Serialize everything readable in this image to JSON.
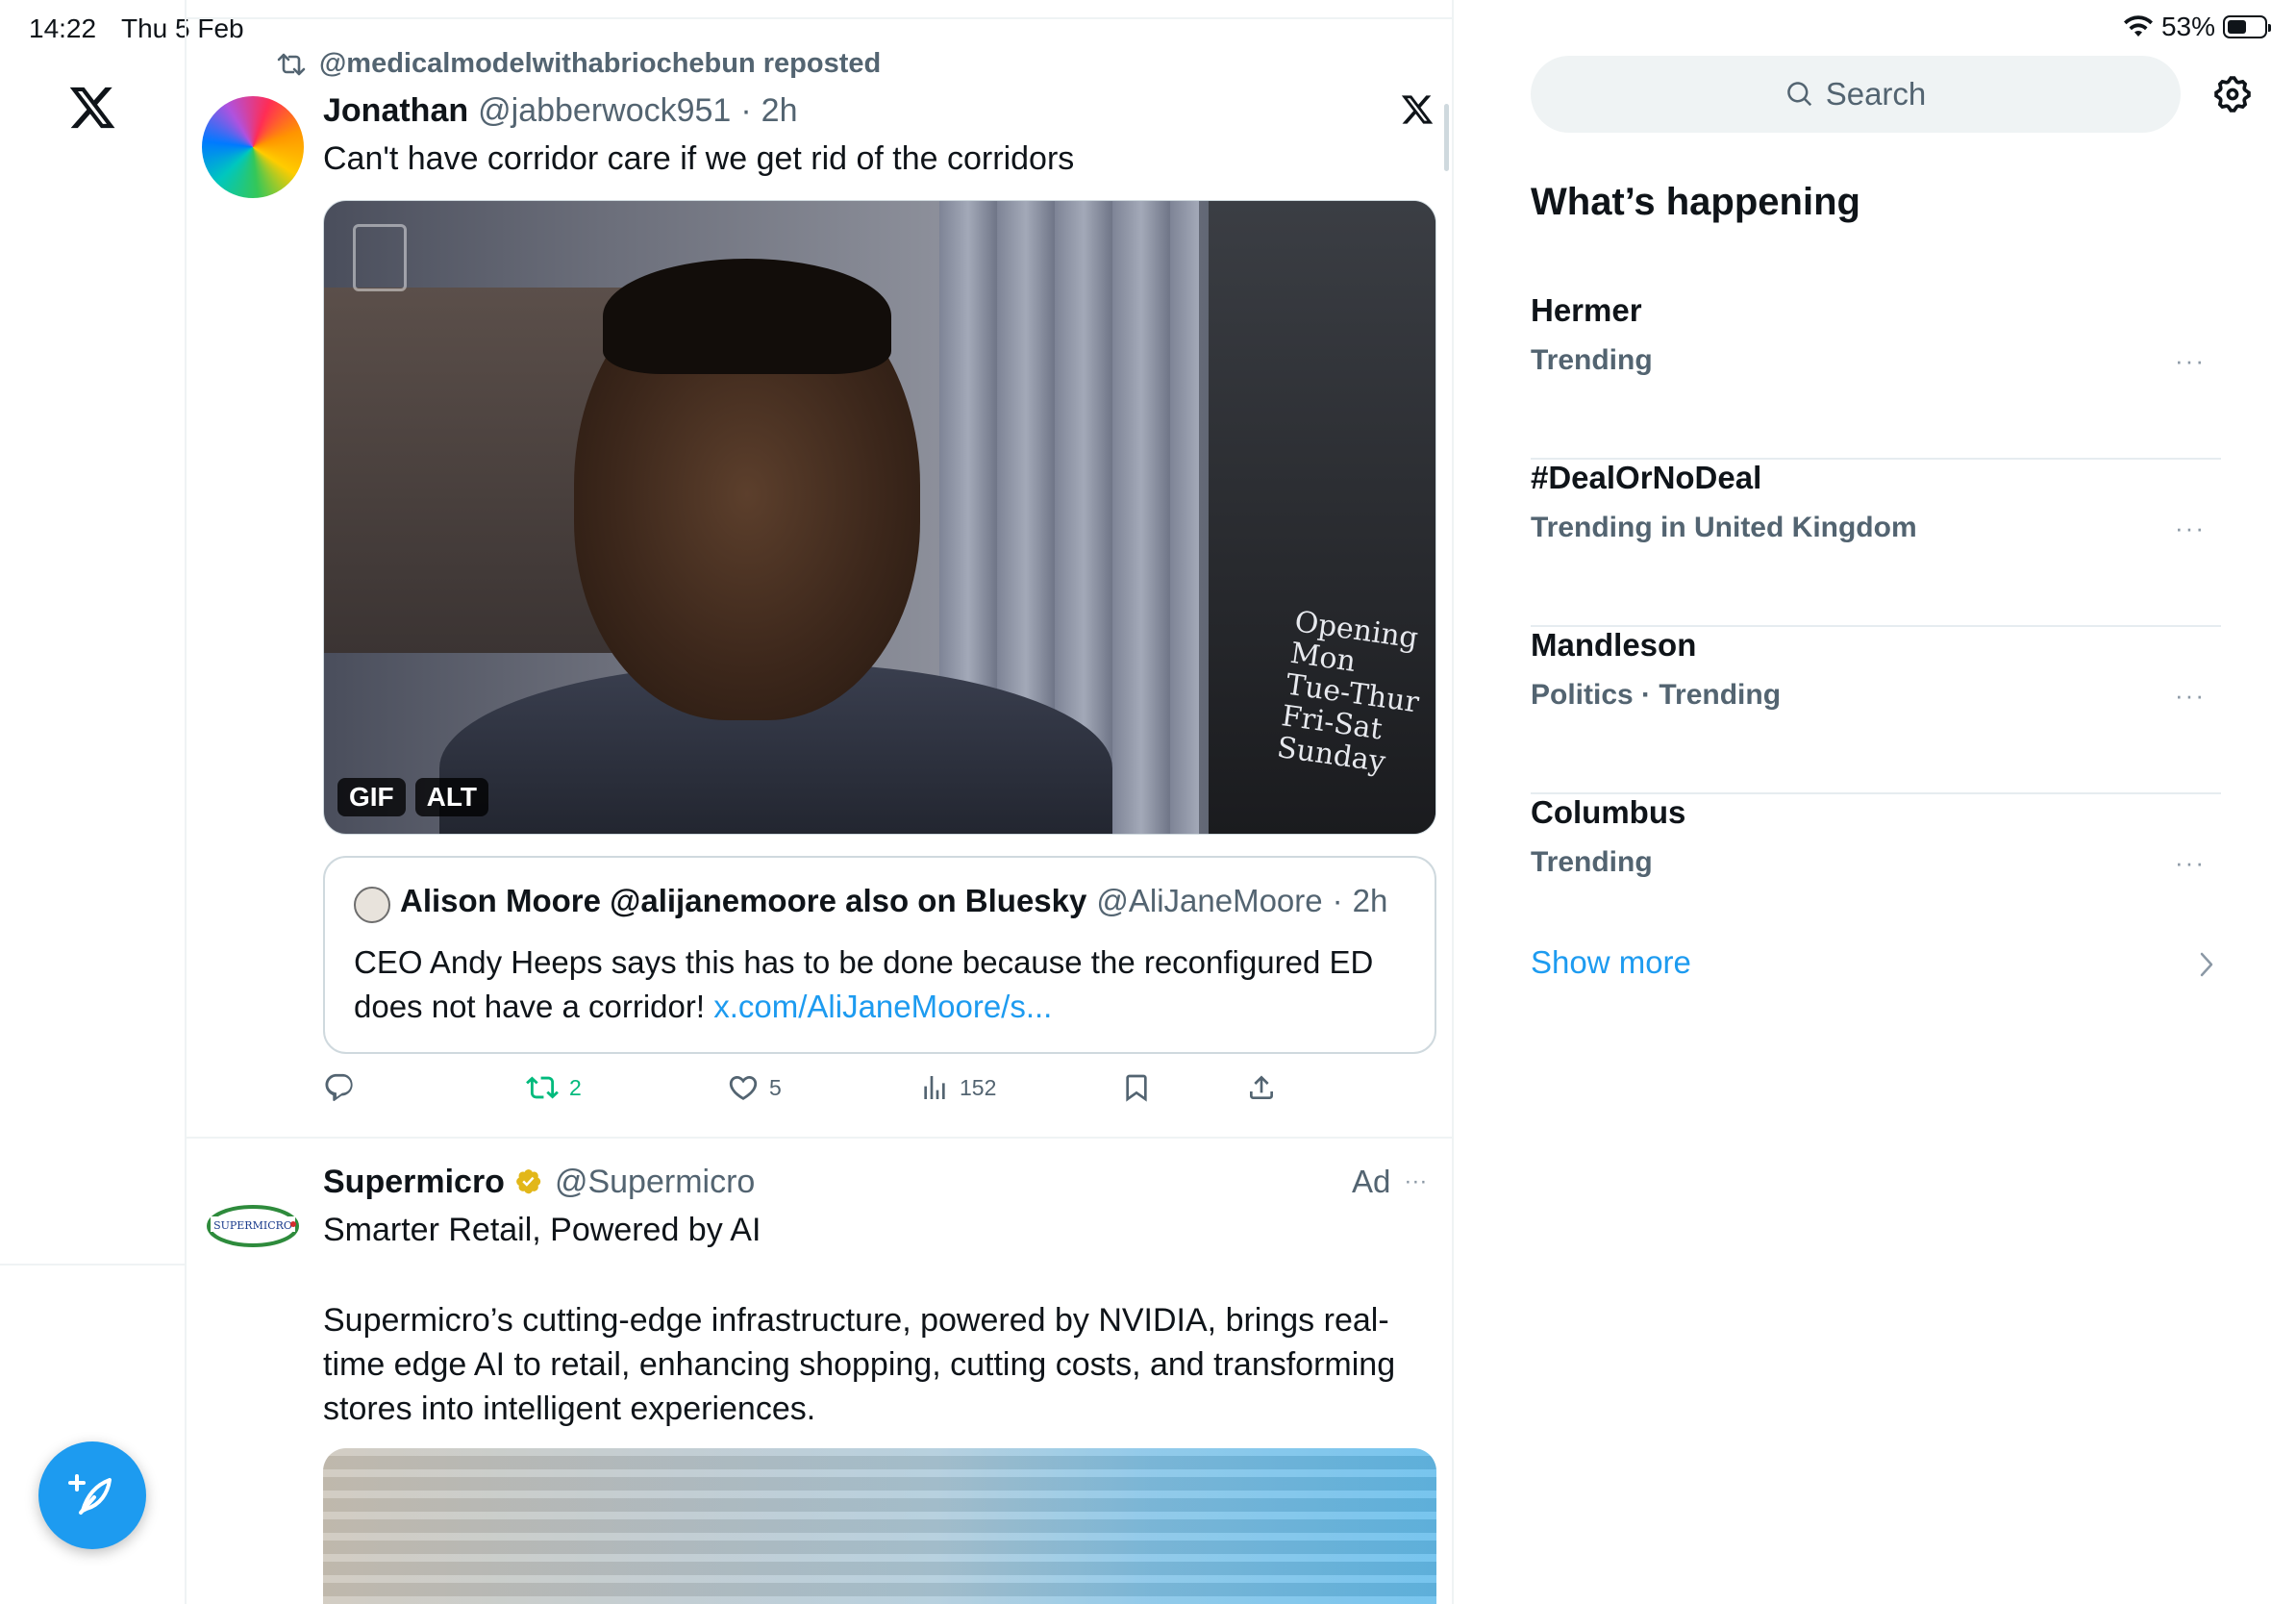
{
  "status_bar": {
    "time": "14:22",
    "date": "Thu 5 Feb",
    "battery": "53%"
  },
  "feed": {
    "repost_label": "@medicalmodelwithabriochebun reposted",
    "tweet": {
      "name": "Jonathan",
      "handle": "@jabberwock951",
      "separator": "·",
      "time": "2h",
      "text": "Can't have corridor care if we get rid of the corridors",
      "media_badges": {
        "gif": "GIF",
        "alt": "ALT"
      },
      "media_sign_text": "Opening\nMon\nTue-Thur\nFri-Sat\nSunday",
      "quote": {
        "name": "Alison Moore @alijanemoore also on Bluesky",
        "handle": "@AliJaneMoore",
        "separator": "·",
        "time": "2h",
        "text": "CEO Andy Heeps says this has to be done because the reconfigured ED does not have a corridor! ",
        "link": "x.com/AliJaneMoore/s..."
      },
      "actions": {
        "reply_count": "",
        "retweet_count": "2",
        "like_count": "5",
        "views_count": "152"
      }
    },
    "ad": {
      "name": "Supermicro",
      "handle": "@Supermicro",
      "ad_label": "Ad",
      "logo_text": "SUPERMICRO",
      "title": "Smarter Retail, Powered by AI",
      "body": "Supermicro’s cutting-edge infrastructure, powered by NVIDIA, brings real-time edge AI to retail, enhancing shopping, cutting costs, and transforming stores into intelligent experiences."
    }
  },
  "sidebar": {
    "search_placeholder": "Search",
    "section_title": "What’s happening",
    "trends": [
      {
        "name": "Hermer",
        "meta": "Trending"
      },
      {
        "name": "#DealOrNoDeal",
        "meta": "Trending in United Kingdom"
      },
      {
        "name": "Mandleson",
        "meta": "Politics · Trending"
      },
      {
        "name": "Columbus",
        "meta": "Trending"
      }
    ],
    "more_glyph": "···",
    "show_more": "Show more"
  },
  "colors": {
    "accent": "#1d9bf0",
    "retweet_green": "#00ba7c",
    "verified_gold": "#e2b719",
    "text_primary": "#0f1419",
    "text_secondary": "#536471"
  }
}
